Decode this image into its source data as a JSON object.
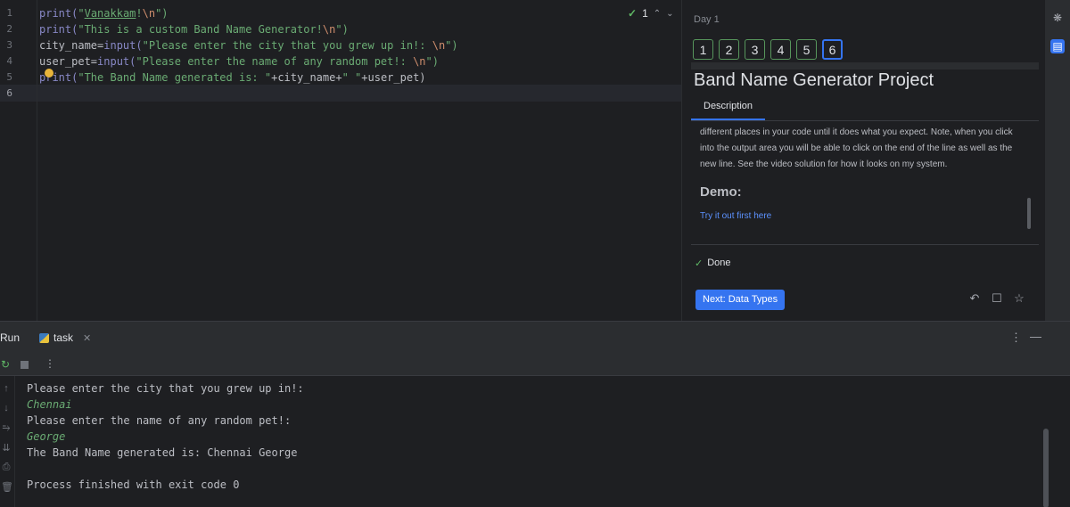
{
  "editor": {
    "line_numbers": [
      "1",
      "2",
      "3",
      "4",
      "5",
      "6"
    ],
    "code": [
      [
        {
          "t": "print(",
          "c": "fn"
        },
        {
          "t": "\"",
          "c": "str"
        },
        {
          "t": "Vanakkam",
          "c": "str ul"
        },
        {
          "t": "!",
          "c": "str"
        },
        {
          "t": "\\n",
          "c": "esc"
        },
        {
          "t": "\")",
          "c": "str"
        }
      ],
      [
        {
          "t": "print(",
          "c": "fn"
        },
        {
          "t": "\"This is a custom Band Name Generator!",
          "c": "str"
        },
        {
          "t": "\\n",
          "c": "esc"
        },
        {
          "t": "\")",
          "c": "str"
        }
      ],
      [
        {
          "t": "city_name=",
          "c": "var"
        },
        {
          "t": "input(",
          "c": "fn"
        },
        {
          "t": "\"Please enter the city that you grew up in!: ",
          "c": "str"
        },
        {
          "t": "\\n",
          "c": "esc"
        },
        {
          "t": "\")",
          "c": "str"
        }
      ],
      [
        {
          "t": "user_pet=",
          "c": "var"
        },
        {
          "t": "input(",
          "c": "fn"
        },
        {
          "t": "\"Please enter the name of any random pet!: ",
          "c": "str"
        },
        {
          "t": "\\n",
          "c": "esc"
        },
        {
          "t": "\")",
          "c": "str"
        }
      ],
      [
        {
          "t": "print(",
          "c": "fn"
        },
        {
          "t": "\"The Band Name generated is: \"",
          "c": "str"
        },
        {
          "t": "+city_name+",
          "c": "var"
        },
        {
          "t": "\" \"",
          "c": "str"
        },
        {
          "t": "+user_pet)",
          "c": "var"
        }
      ],
      []
    ],
    "inspection_count": "1"
  },
  "task": {
    "day_label": "Day 1",
    "steps": [
      "1",
      "2",
      "3",
      "4",
      "5",
      "6"
    ],
    "active_step": "6",
    "title": "Band Name Generator Project",
    "tab_label": "Description",
    "description_lines": [
      "different places in your code until it does what you expect. Note, when you click",
      "into the output area you will be able to click on the end of the line as well as the",
      "new line. See the video solution for how it looks on my system."
    ],
    "demo_heading": "Demo:",
    "demo_link": "Try it out first here",
    "done_label": "Done",
    "next_button": "Next: Data Types"
  },
  "run": {
    "panel_label": "Run",
    "tab_label": "task",
    "output": [
      {
        "text": "Please enter the city that you grew up in!:",
        "type": "out"
      },
      {
        "text": "Chennai",
        "type": "in"
      },
      {
        "text": "Please enter the name of any random pet!:",
        "type": "out"
      },
      {
        "text": "George",
        "type": "in"
      },
      {
        "text": "The Band Name generated is: Chennai George",
        "type": "out"
      },
      {
        "text": "",
        "type": "out"
      },
      {
        "text": "Process finished with exit code 0",
        "type": "out"
      }
    ]
  },
  "icons": {
    "check": "✓",
    "undo": "↶",
    "comment": "☐",
    "star": "☆",
    "more": "⋮",
    "minimize": "—",
    "close": "✕",
    "rerun": "↻",
    "up": "↑",
    "down": "↓",
    "soft_wrap": "⥱",
    "scroll_end": "⇊",
    "print": "⎙",
    "trash": "🗑"
  },
  "colors": {
    "accent": "#3574f0",
    "success": "#5fb865",
    "string": "#6aab73",
    "escape": "#cf8e6d",
    "builtin": "#8888c6",
    "background": "#1e1f22"
  }
}
